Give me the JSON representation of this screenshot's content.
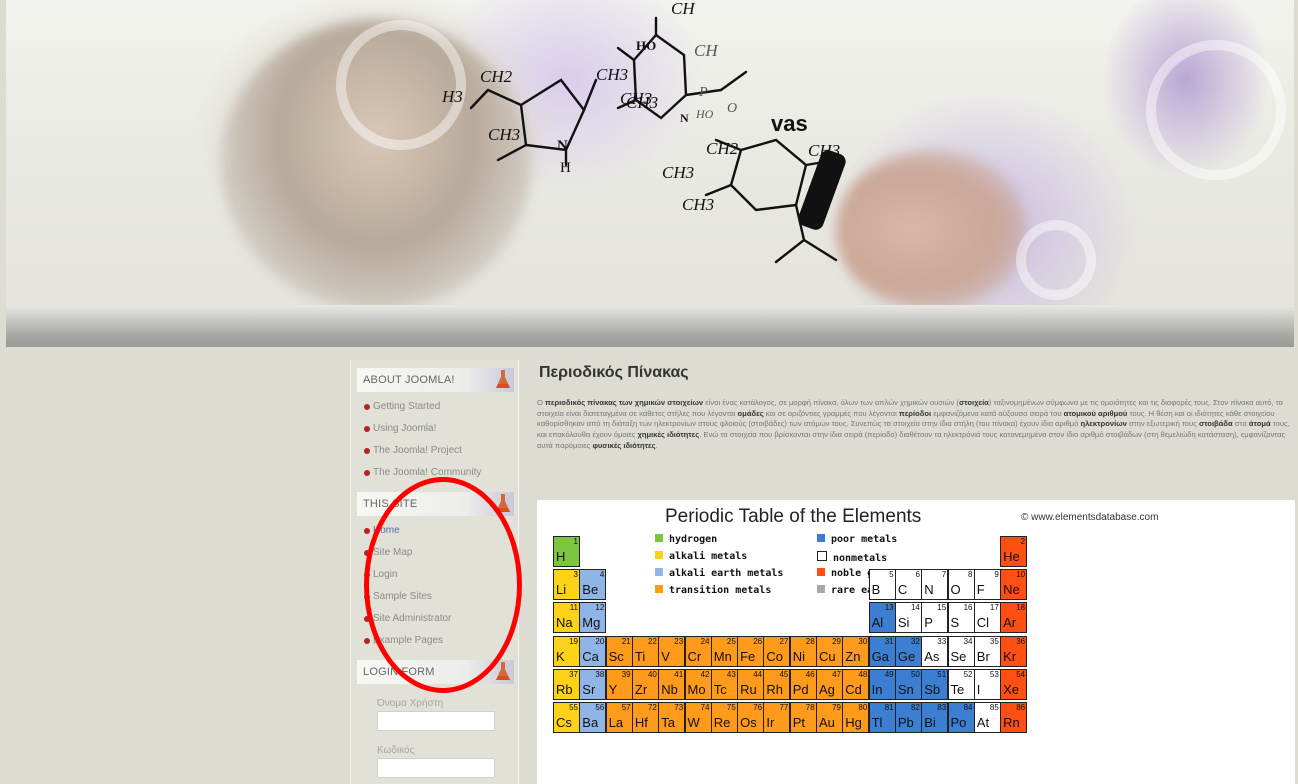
{
  "header": {
    "overlay_text": "vas",
    "formula_labels": [
      "CH",
      "HO",
      "CH",
      "CH3",
      "CH2",
      "CH3",
      "H3",
      "CH3",
      "N",
      "H",
      "CH3",
      "CH2",
      "CH3",
      "CH3",
      "CH3",
      "P",
      "O",
      "HO",
      "N"
    ]
  },
  "sidebar": {
    "modules": [
      {
        "title": "ABOUT JOOMLA!",
        "items": [
          "Getting Started",
          "Using Joomla!",
          "The Joomla! Project",
          "The Joomla! Community"
        ]
      },
      {
        "title": "THIS SITE",
        "items": [
          "Home",
          "Site Map",
          "Login",
          "Sample Sites",
          "Site Administrator",
          "Example Pages"
        ]
      },
      {
        "title": "LOGIN FORM"
      }
    ],
    "login": {
      "username_label": "Όνομα Χρήστη",
      "password_label": "Κωδικός"
    }
  },
  "main": {
    "title": "Περιοδικός Πίνακας",
    "intro_parts": [
      "Ο ",
      "περιοδικός πίνακας των χημικών στοιχείων",
      " είναι ένας κατάλογος, σε μορφή πίνακα, όλων των απλών χημικών ουσιών (",
      "στοιχεία",
      ") ταξινομημένων σύμφωνα με τις ομοιότητες και τις διαφορές τους. Στον πίνακα αυτό, τα στοιχεία είναι διατεταγμένα σε κάθετες στήλες που λέγονται ",
      "ομάδες",
      " και σε οριζόντιες γραμμές που λέγονται ",
      "περίοδοι",
      " εμφανιζόμενα κατά αύξουσα σειρά του ",
      "ατομικού αριθμού",
      " τους. Η θέση και οι ιδιότητες κάθε στοιχείου καθορίσθηκαν από τη διάταξη των ηλεκτρονίων στους φλοιούς (στοιβάδες) των ατόμων τους. Συνεπώς τα στοιχεία στην ίδια στήλη (του πίνακα) έχουν ίδιο αριθμό ",
      "ηλεκτρονίων",
      " στην εξωτερική τους ",
      "στοιβάδα",
      " στα ",
      "άτομά",
      " τους, και επακόλουθα έχουν όμοιες ",
      "χημικές ιδιότητες",
      ". Ενώ τα στοιχεία που βρίσκονται στην ίδια σειρά (περίοδο) διαθέτουν τα ηλεκτρόνιά τους κατανεμημένα στον ίδιο αριθμό στοιβάδων (στη θεμελιώδη κατάσταση), εμφανίζοντας αυτά παρόμοιες ",
      "φυσικές ιδιότητες",
      "."
    ]
  },
  "periodic_table": {
    "title": "Periodic Table of the Elements",
    "copyright": "© www.elementsdatabase.com",
    "legend": [
      {
        "label": "hydrogen",
        "color": "#7cc540"
      },
      {
        "label": "alkali metals",
        "color": "#ffd21a"
      },
      {
        "label": "alkali earth metals",
        "color": "#8fb4e6"
      },
      {
        "label": "transition metals",
        "color": "#ff9a1a"
      },
      {
        "label": "poor metals",
        "color": "#3c7fd2"
      },
      {
        "label": "nonmetals",
        "color": "#ffffff"
      },
      {
        "label": "noble gases",
        "color": "#ff4f12"
      },
      {
        "label": "rare earth metals",
        "color": "#a8a8a8"
      }
    ],
    "elements": [
      {
        "sym": "H",
        "num": "1",
        "row": 1,
        "col": 1,
        "cat": "hydrogen"
      },
      {
        "sym": "He",
        "num": "2",
        "row": 1,
        "col": 18,
        "cat": "noble"
      },
      {
        "sym": "Li",
        "num": "3",
        "row": 2,
        "col": 1,
        "cat": "alkali"
      },
      {
        "sym": "Be",
        "num": "4",
        "row": 2,
        "col": 2,
        "cat": "earth"
      },
      {
        "sym": "B",
        "num": "5",
        "row": 2,
        "col": 13,
        "cat": "nonmetal"
      },
      {
        "sym": "C",
        "num": "6",
        "row": 2,
        "col": 14,
        "cat": "nonmetal"
      },
      {
        "sym": "N",
        "num": "7",
        "row": 2,
        "col": 15,
        "cat": "nonmetal"
      },
      {
        "sym": "O",
        "num": "8",
        "row": 2,
        "col": 16,
        "cat": "nonmetal"
      },
      {
        "sym": "F",
        "num": "9",
        "row": 2,
        "col": 17,
        "cat": "nonmetal"
      },
      {
        "sym": "Ne",
        "num": "10",
        "row": 2,
        "col": 18,
        "cat": "noble"
      },
      {
        "sym": "Na",
        "num": "11",
        "row": 3,
        "col": 1,
        "cat": "alkali"
      },
      {
        "sym": "Mg",
        "num": "12",
        "row": 3,
        "col": 2,
        "cat": "earth"
      },
      {
        "sym": "Al",
        "num": "13",
        "row": 3,
        "col": 13,
        "cat": "poor"
      },
      {
        "sym": "Si",
        "num": "14",
        "row": 3,
        "col": 14,
        "cat": "nonmetal"
      },
      {
        "sym": "P",
        "num": "15",
        "row": 3,
        "col": 15,
        "cat": "nonmetal"
      },
      {
        "sym": "S",
        "num": "16",
        "row": 3,
        "col": 16,
        "cat": "nonmetal"
      },
      {
        "sym": "Cl",
        "num": "17",
        "row": 3,
        "col": 17,
        "cat": "nonmetal"
      },
      {
        "sym": "Ar",
        "num": "18",
        "row": 3,
        "col": 18,
        "cat": "noble"
      },
      {
        "sym": "K",
        "num": "19",
        "row": 4,
        "col": 1,
        "cat": "alkali"
      },
      {
        "sym": "Ca",
        "num": "20",
        "row": 4,
        "col": 2,
        "cat": "earth"
      },
      {
        "sym": "Sc",
        "num": "21",
        "row": 4,
        "col": 3,
        "cat": "transition"
      },
      {
        "sym": "Ti",
        "num": "22",
        "row": 4,
        "col": 4,
        "cat": "transition"
      },
      {
        "sym": "V",
        "num": "23",
        "row": 4,
        "col": 5,
        "cat": "transition"
      },
      {
        "sym": "Cr",
        "num": "24",
        "row": 4,
        "col": 6,
        "cat": "transition"
      },
      {
        "sym": "Mn",
        "num": "25",
        "row": 4,
        "col": 7,
        "cat": "transition"
      },
      {
        "sym": "Fe",
        "num": "26",
        "row": 4,
        "col": 8,
        "cat": "transition"
      },
      {
        "sym": "Co",
        "num": "27",
        "row": 4,
        "col": 9,
        "cat": "transition"
      },
      {
        "sym": "Ni",
        "num": "28",
        "row": 4,
        "col": 10,
        "cat": "transition"
      },
      {
        "sym": "Cu",
        "num": "29",
        "row": 4,
        "col": 11,
        "cat": "transition"
      },
      {
        "sym": "Zn",
        "num": "30",
        "row": 4,
        "col": 12,
        "cat": "transition"
      },
      {
        "sym": "Ga",
        "num": "31",
        "row": 4,
        "col": 13,
        "cat": "poor"
      },
      {
        "sym": "Ge",
        "num": "32",
        "row": 4,
        "col": 14,
        "cat": "poor"
      },
      {
        "sym": "As",
        "num": "33",
        "row": 4,
        "col": 15,
        "cat": "nonmetal"
      },
      {
        "sym": "Se",
        "num": "34",
        "row": 4,
        "col": 16,
        "cat": "nonmetal"
      },
      {
        "sym": "Br",
        "num": "35",
        "row": 4,
        "col": 17,
        "cat": "nonmetal"
      },
      {
        "sym": "Kr",
        "num": "36",
        "row": 4,
        "col": 18,
        "cat": "noble"
      },
      {
        "sym": "Rb",
        "num": "37",
        "row": 5,
        "col": 1,
        "cat": "alkali"
      },
      {
        "sym": "Sr",
        "num": "38",
        "row": 5,
        "col": 2,
        "cat": "earth"
      },
      {
        "sym": "Y",
        "num": "39",
        "row": 5,
        "col": 3,
        "cat": "transition"
      },
      {
        "sym": "Zr",
        "num": "40",
        "row": 5,
        "col": 4,
        "cat": "transition"
      },
      {
        "sym": "Nb",
        "num": "41",
        "row": 5,
        "col": 5,
        "cat": "transition"
      },
      {
        "sym": "Mo",
        "num": "42",
        "row": 5,
        "col": 6,
        "cat": "transition"
      },
      {
        "sym": "Tc",
        "num": "43",
        "row": 5,
        "col": 7,
        "cat": "transition"
      },
      {
        "sym": "Ru",
        "num": "44",
        "row": 5,
        "col": 8,
        "cat": "transition"
      },
      {
        "sym": "Rh",
        "num": "45",
        "row": 5,
        "col": 9,
        "cat": "transition"
      },
      {
        "sym": "Pd",
        "num": "46",
        "row": 5,
        "col": 10,
        "cat": "transition"
      },
      {
        "sym": "Ag",
        "num": "47",
        "row": 5,
        "col": 11,
        "cat": "transition"
      },
      {
        "sym": "Cd",
        "num": "48",
        "row": 5,
        "col": 12,
        "cat": "transition"
      },
      {
        "sym": "In",
        "num": "49",
        "row": 5,
        "col": 13,
        "cat": "poor"
      },
      {
        "sym": "Sn",
        "num": "50",
        "row": 5,
        "col": 14,
        "cat": "poor"
      },
      {
        "sym": "Sb",
        "num": "51",
        "row": 5,
        "col": 15,
        "cat": "poor"
      },
      {
        "sym": "Te",
        "num": "52",
        "row": 5,
        "col": 16,
        "cat": "nonmetal"
      },
      {
        "sym": "I",
        "num": "53",
        "row": 5,
        "col": 17,
        "cat": "nonmetal"
      },
      {
        "sym": "Xe",
        "num": "54",
        "row": 5,
        "col": 18,
        "cat": "noble"
      },
      {
        "sym": "Cs",
        "num": "55",
        "row": 6,
        "col": 1,
        "cat": "alkali"
      },
      {
        "sym": "Ba",
        "num": "56",
        "row": 6,
        "col": 2,
        "cat": "earth"
      },
      {
        "sym": "La",
        "num": "57",
        "row": 6,
        "col": 3,
        "cat": "transition"
      },
      {
        "sym": "Hf",
        "num": "72",
        "row": 6,
        "col": 4,
        "cat": "transition"
      },
      {
        "sym": "Ta",
        "num": "73",
        "row": 6,
        "col": 5,
        "cat": "transition"
      },
      {
        "sym": "W",
        "num": "74",
        "row": 6,
        "col": 6,
        "cat": "transition"
      },
      {
        "sym": "Re",
        "num": "75",
        "row": 6,
        "col": 7,
        "cat": "transition"
      },
      {
        "sym": "Os",
        "num": "76",
        "row": 6,
        "col": 8,
        "cat": "transition"
      },
      {
        "sym": "Ir",
        "num": "77",
        "row": 6,
        "col": 9,
        "cat": "transition"
      },
      {
        "sym": "Pt",
        "num": "78",
        "row": 6,
        "col": 10,
        "cat": "transition"
      },
      {
        "sym": "Au",
        "num": "79",
        "row": 6,
        "col": 11,
        "cat": "transition"
      },
      {
        "sym": "Hg",
        "num": "80",
        "row": 6,
        "col": 12,
        "cat": "transition"
      },
      {
        "sym": "Tl",
        "num": "81",
        "row": 6,
        "col": 13,
        "cat": "poor"
      },
      {
        "sym": "Pb",
        "num": "82",
        "row": 6,
        "col": 14,
        "cat": "poor"
      },
      {
        "sym": "Bi",
        "num": "83",
        "row": 6,
        "col": 15,
        "cat": "poor"
      },
      {
        "sym": "Po",
        "num": "84",
        "row": 6,
        "col": 16,
        "cat": "poor"
      },
      {
        "sym": "At",
        "num": "85",
        "row": 6,
        "col": 17,
        "cat": "nonmetal"
      },
      {
        "sym": "Rn",
        "num": "86",
        "row": 6,
        "col": 18,
        "cat": "noble"
      }
    ],
    "category_colors": {
      "hydrogen": "#7cc540",
      "alkali": "#ffd21a",
      "earth": "#8fb4e6",
      "transition": "#ff9a1a",
      "poor": "#3c7fd2",
      "nonmetal": "#ffffff",
      "noble": "#ff4f12",
      "rare": "#a8a8a8"
    }
  }
}
